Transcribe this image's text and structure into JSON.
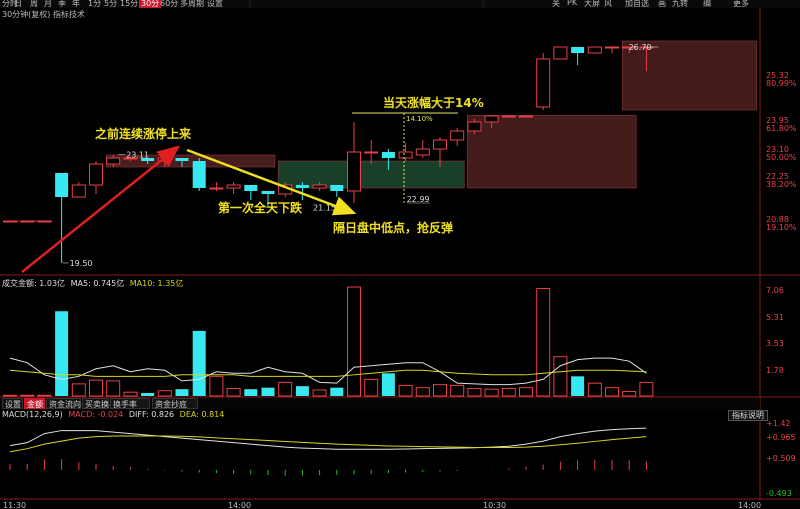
{
  "toolbar": {
    "timeframes": [
      "分时",
      "日",
      "周",
      "月",
      "季",
      "年",
      "1分",
      "5分",
      "15分",
      "30分",
      "60分",
      "多周期",
      "设置"
    ],
    "active_timeframe": "30分",
    "right_items": [
      "关",
      "PK",
      "大屏",
      "风",
      "加自选",
      "画",
      "九转",
      "编",
      "更多"
    ]
  },
  "subtitle": "30分钟(复权)  指标技术",
  "colors": {
    "up": "#e8404a",
    "down": "#38e8f0",
    "arrow_red": "#e02020",
    "arrow_yellow": "#f0e020",
    "box_red": "#5a2424",
    "box_green": "#1e4a30",
    "ma_white": "#e0e0e0",
    "ma_yellow": "#d8d820",
    "bg": "#000000"
  },
  "annotations": {
    "before": "之前连续涨停上来",
    "first_drop": "第一次全天下跌",
    "low_buy": "隔日盘中低点，抢反弹",
    "surge": "当天涨幅大于14%"
  },
  "price_labels": {
    "p2311": "23.11",
    "p1950": "19.50",
    "p2115": "21.15",
    "p2299": "22.99",
    "p2670": "26.70",
    "pct": "14.10%"
  },
  "volume_panel": {
    "header_label": "成交金额: 1.03亿",
    "ma5_label": "MA5: 0.745亿",
    "ma10_label": "MA10: 1.35亿"
  },
  "macd_panel": {
    "header_label": "MACD(12,26,9)",
    "macd_label": "MACD: -0.024",
    "diff_label": "DIFF: 0.826",
    "dea_label": "DEA: 0.814",
    "button_label": "指标说明"
  },
  "tabs": [
    "设置",
    "金额",
    "资金流向",
    "买卖换手率",
    "换手率",
    "资金抄底"
  ],
  "active_tab": "金额",
  "chart_data": [
    {
      "type": "candlestick",
      "title": "30分钟(复权)",
      "y_ticks": [
        "25.32",
        "80.99%",
        "23.95",
        "61.80%",
        "23.10",
        "50.00%",
        "22.25",
        "38.20%",
        "20.88",
        "19.10%"
      ],
      "x_ticks": [
        "11:30",
        "14:00",
        "10:30",
        "14:00"
      ],
      "ylim": [
        19.2,
        27.6
      ],
      "candles": [
        {
          "o": 20.9,
          "c": 20.9,
          "h": 20.9,
          "l": 20.9
        },
        {
          "o": 20.9,
          "c": 20.9,
          "h": 20.9,
          "l": 20.9
        },
        {
          "o": 20.9,
          "c": 20.9,
          "h": 20.9,
          "l": 20.9
        },
        {
          "o": 22.5,
          "c": 21.7,
          "h": 22.5,
          "l": 19.5
        },
        {
          "o": 21.7,
          "c": 22.1,
          "h": 22.2,
          "l": 21.7
        },
        {
          "o": 22.1,
          "c": 22.8,
          "h": 22.9,
          "l": 21.8
        },
        {
          "o": 22.8,
          "c": 23.0,
          "h": 23.11,
          "l": 22.7
        },
        {
          "o": 23.0,
          "c": 23.0,
          "h": 23.0,
          "l": 22.9
        },
        {
          "o": 23.0,
          "c": 22.9,
          "h": 23.0,
          "l": 22.8
        },
        {
          "o": 22.9,
          "c": 23.0,
          "h": 23.0,
          "l": 22.7
        },
        {
          "o": 23.0,
          "c": 22.9,
          "h": 23.0,
          "l": 22.7
        },
        {
          "o": 22.9,
          "c": 22.0,
          "h": 23.0,
          "l": 21.9
        },
        {
          "o": 22.0,
          "c": 22.0,
          "h": 22.2,
          "l": 21.9
        },
        {
          "o": 22.0,
          "c": 22.1,
          "h": 22.2,
          "l": 21.8
        },
        {
          "o": 22.1,
          "c": 21.9,
          "h": 22.1,
          "l": 21.6
        },
        {
          "o": 21.9,
          "c": 21.8,
          "h": 21.9,
          "l": 21.4
        },
        {
          "o": 21.8,
          "c": 22.1,
          "h": 22.2,
          "l": 21.7
        },
        {
          "o": 22.1,
          "c": 22.0,
          "h": 22.2,
          "l": 21.6
        },
        {
          "o": 22.0,
          "c": 22.1,
          "h": 22.2,
          "l": 21.9
        },
        {
          "o": 22.1,
          "c": 21.9,
          "h": 22.1,
          "l": 21.7
        },
        {
          "o": 21.9,
          "c": 23.2,
          "h": 24.2,
          "l": 21.5
        },
        {
          "o": 23.2,
          "c": 23.2,
          "h": 23.6,
          "l": 22.8
        },
        {
          "o": 23.2,
          "c": 23.0,
          "h": 23.3,
          "l": 22.6
        },
        {
          "o": 23.0,
          "c": 23.2,
          "h": 23.5,
          "l": 22.9
        },
        {
          "o": 23.1,
          "c": 23.3,
          "h": 23.6,
          "l": 23.0
        },
        {
          "o": 23.3,
          "c": 23.6,
          "h": 23.7,
          "l": 22.7
        },
        {
          "o": 23.6,
          "c": 23.9,
          "h": 24.0,
          "l": 23.4
        },
        {
          "o": 23.9,
          "c": 24.2,
          "h": 24.3,
          "l": 23.8
        },
        {
          "o": 24.2,
          "c": 24.4,
          "h": 24.4,
          "l": 24.0
        },
        {
          "o": 24.4,
          "c": 24.4,
          "h": 24.4,
          "l": 24.4
        },
        {
          "o": 24.4,
          "c": 24.4,
          "h": 24.4,
          "l": 24.4
        },
        {
          "o": 24.7,
          "c": 26.3,
          "h": 26.5,
          "l": 24.6
        },
        {
          "o": 26.3,
          "c": 26.7,
          "h": 26.7,
          "l": 26.3
        },
        {
          "o": 26.7,
          "c": 26.5,
          "h": 26.7,
          "l": 26.1
        },
        {
          "o": 26.5,
          "c": 26.7,
          "h": 26.7,
          "l": 26.5
        },
        {
          "o": 26.7,
          "c": 26.7,
          "h": 26.7,
          "l": 26.5
        },
        {
          "o": 26.7,
          "c": 26.7,
          "h": 26.7,
          "l": 26.5
        },
        {
          "o": 26.7,
          "c": 26.7,
          "h": 26.7,
          "l": 25.9
        }
      ]
    },
    {
      "type": "bar",
      "title": "成交金额",
      "y_ticks": [
        "7.06",
        "5.31",
        "3.53",
        "1.78"
      ],
      "ylim": [
        0,
        7.4
      ],
      "series": [
        {
          "name": "成交金额",
          "values": [
            0.05,
            0.05,
            0.05,
            5.6,
            0.8,
            1.05,
            1.0,
            0.25,
            0.2,
            0.35,
            0.45,
            4.3,
            1.3,
            0.5,
            0.45,
            0.55,
            0.9,
            0.65,
            0.4,
            0.55,
            7.2,
            1.1,
            1.5,
            0.7,
            0.55,
            0.75,
            0.7,
            0.5,
            0.45,
            0.5,
            0.55,
            7.1,
            2.6,
            1.3,
            0.85,
            0.55,
            0.3,
            0.9
          ]
        },
        {
          "name": "MA5",
          "values": [
            2.5,
            2.2,
            1.4,
            1.1,
            1.3,
            1.8,
            2.0,
            1.6,
            1.8,
            1.7,
            1.0,
            1.1,
            1.6,
            1.5,
            1.5,
            1.9,
            1.6,
            1.5,
            0.9,
            0.85,
            1.9,
            2.0,
            2.1,
            2.2,
            2.2,
            1.6,
            0.85,
            0.8,
            0.75,
            0.75,
            0.85,
            1.1,
            2.0,
            2.4,
            2.5,
            2.5,
            2.3,
            1.5
          ]
        },
        {
          "name": "MA10",
          "values": [
            1.7,
            1.6,
            1.5,
            1.4,
            1.4,
            1.3,
            1.3,
            1.3,
            1.3,
            1.3,
            1.4,
            1.4,
            1.4,
            1.4,
            1.3,
            1.3,
            1.3,
            1.3,
            1.3,
            1.3,
            1.4,
            1.5,
            1.6,
            1.7,
            1.7,
            1.6,
            1.5,
            1.45,
            1.4,
            1.4,
            1.4,
            1.5,
            1.6,
            1.7,
            1.7,
            1.7,
            1.65,
            1.6
          ]
        }
      ]
    },
    {
      "type": "line",
      "title": "MACD(12,26,9)",
      "y_ticks": [
        "+1.42",
        "+0.965",
        "+0.509",
        "-0.493"
      ],
      "ylim": [
        -0.9,
        1.65
      ],
      "series": [
        {
          "name": "DIFF",
          "values": [
            0.8,
            0.9,
            1.2,
            1.3,
            1.3,
            1.3,
            1.25,
            1.2,
            1.15,
            1.1,
            1.05,
            1.0,
            0.95,
            0.9,
            0.85,
            0.8,
            0.75,
            0.72,
            0.7,
            0.68,
            0.68,
            0.68,
            0.68,
            0.69,
            0.7,
            0.71,
            0.72,
            0.73,
            0.75,
            0.78,
            0.85,
            0.95,
            1.1,
            1.2,
            1.28,
            1.33,
            1.36,
            1.38
          ]
        },
        {
          "name": "DEA",
          "values": [
            0.6,
            0.7,
            0.85,
            0.95,
            1.05,
            1.1,
            1.12,
            1.12,
            1.12,
            1.12,
            1.11,
            1.09,
            1.06,
            1.03,
            1.0,
            0.97,
            0.94,
            0.91,
            0.88,
            0.85,
            0.83,
            0.81,
            0.79,
            0.78,
            0.77,
            0.76,
            0.75,
            0.74,
            0.74,
            0.74,
            0.75,
            0.78,
            0.83,
            0.88,
            0.94,
            1.0,
            1.05,
            1.1
          ]
        },
        {
          "name": "MACD",
          "values": [
            0.2,
            0.2,
            0.35,
            0.35,
            0.25,
            0.2,
            0.13,
            0.08,
            0.03,
            -0.02,
            -0.06,
            -0.09,
            -0.11,
            -0.13,
            -0.15,
            -0.17,
            -0.19,
            -0.19,
            -0.18,
            -0.17,
            -0.15,
            -0.13,
            -0.11,
            -0.09,
            -0.07,
            -0.05,
            -0.03,
            -0.01,
            0.01,
            0.04,
            0.1,
            0.17,
            0.27,
            0.32,
            0.34,
            0.33,
            0.31,
            0.28
          ]
        }
      ]
    }
  ]
}
